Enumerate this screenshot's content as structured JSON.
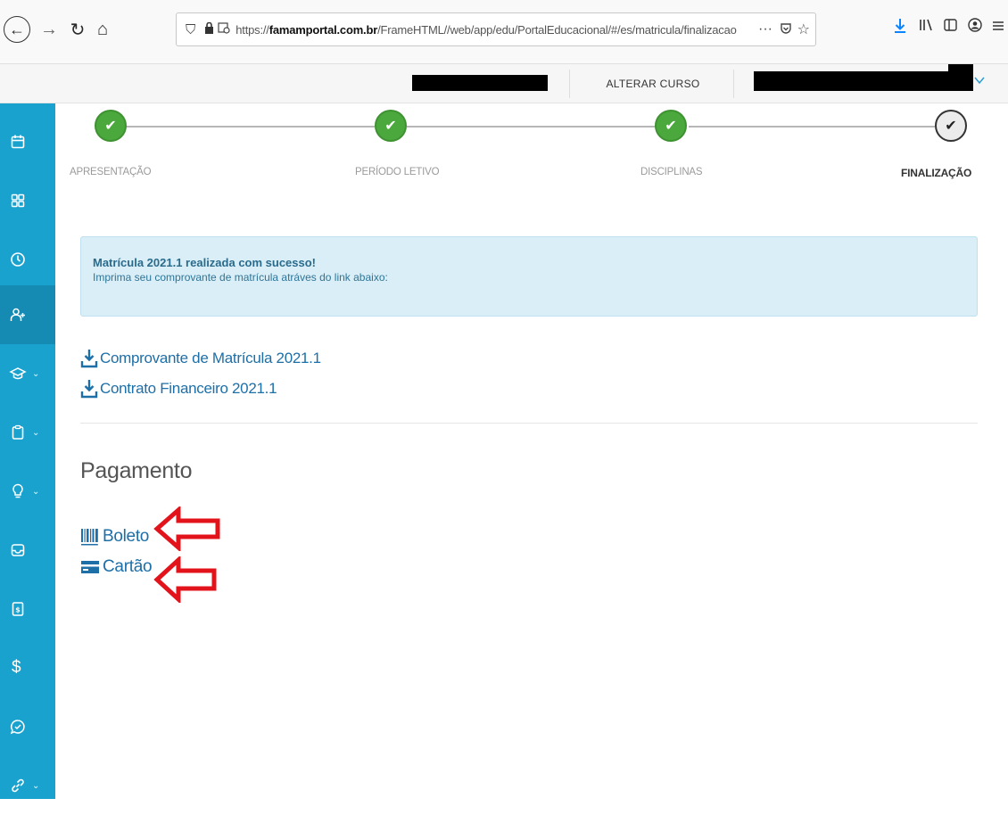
{
  "browser": {
    "url_host": "famamportal.com.br",
    "url_prefix": "https://",
    "url_path": "/FrameHTML//web/app/edu/PortalEducacional/#/es/matricula/finalizacao",
    "more_label": "···"
  },
  "header": {
    "course_button": "ALTERAR CURSO"
  },
  "sidebar": {
    "items": [
      {
        "icon": "calendar-icon"
      },
      {
        "icon": "grid-icon"
      },
      {
        "icon": "clock-icon"
      },
      {
        "icon": "add-user-icon",
        "active": true
      },
      {
        "icon": "graduation-cap-icon",
        "chevron": "⌄"
      },
      {
        "icon": "clipboard-icon",
        "chevron": "⌄"
      },
      {
        "icon": "lightbulb-icon",
        "chevron": "⌄"
      },
      {
        "icon": "inbox-icon"
      },
      {
        "icon": "invoice-icon"
      },
      {
        "icon": "dollar-icon",
        "label": "$"
      },
      {
        "icon": "chat-icon"
      },
      {
        "icon": "link-icon",
        "chevron": "⌄"
      }
    ]
  },
  "steps": [
    {
      "label": "APRESENTAÇÃO",
      "status": "done"
    },
    {
      "label": "PERÍODO LETIVO",
      "status": "done"
    },
    {
      "label": "DISCIPLINAS",
      "status": "done"
    },
    {
      "label": "FINALIZAÇÃO",
      "status": "current"
    }
  ],
  "alert": {
    "title": "Matrícula 2021.1 realizada com sucesso!",
    "text": "Imprima seu comprovante de matrícula atráves do link abaixo:"
  },
  "downloads": [
    {
      "label": "Comprovante de Matrícula 2021.1"
    },
    {
      "label": "Contrato Financeiro 2021.1"
    }
  ],
  "payment": {
    "title": "Pagamento",
    "options": [
      {
        "label": "Boleto",
        "icon": "barcode-icon"
      },
      {
        "label": "Cartão",
        "icon": "credit-card-icon"
      }
    ]
  },
  "colors": {
    "sidebar": "#1aa2cf",
    "link": "#1d6fa8",
    "step_done": "#4aa83c",
    "annotation_arrow": "#e3131b"
  }
}
